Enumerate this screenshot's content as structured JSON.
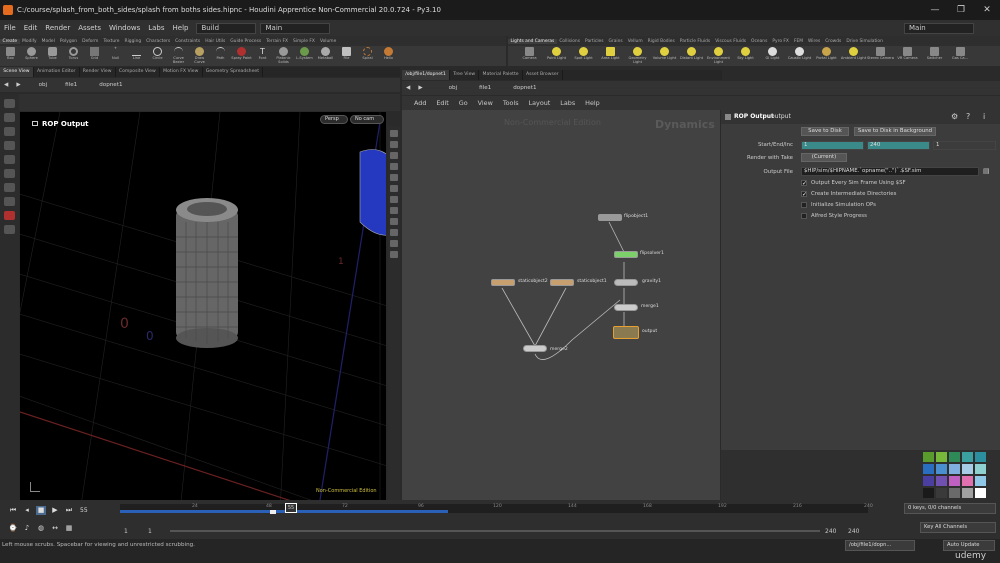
{
  "window": {
    "title": "C:/course/splash_from_both_sides/splash from boths sides.hipnc - Houdini Apprentice Non-Commercial 20.0.724 - Py3.10",
    "controls": [
      "—",
      "❐",
      "✕"
    ]
  },
  "menubar": {
    "items": [
      "File",
      "Edit",
      "Render",
      "Assets",
      "Windows",
      "Labs",
      "Help"
    ],
    "build": "Build",
    "main": "Main",
    "main_right": "Main"
  },
  "shelf_left": {
    "tabs": [
      "Create",
      "Modify",
      "Model",
      "Polygon",
      "Deform",
      "Texture",
      "Rigging",
      "Characters",
      "Constraints",
      "Hair Utils",
      "Guide Process",
      "Terrain FX",
      "Simple FX",
      "Volume"
    ],
    "tools": [
      "Box",
      "Sphere",
      "Tube",
      "Torus",
      "Grid",
      "Null",
      "Line",
      "Circle",
      "Curve Bezier",
      "Draw Curve",
      "Path",
      "Spray Paint",
      "Font",
      "Platonic Solids",
      "L-System",
      "Metaball",
      "File",
      "Spiral",
      "Helix"
    ]
  },
  "shelf_right": {
    "tabs": [
      "Lights and Cameras",
      "Collisions",
      "Particles",
      "Grains",
      "Vellum",
      "Rigid Bodies",
      "Particle Fluids",
      "Viscous Fluids",
      "Oceans",
      "Pyro FX",
      "FEM",
      "Wires",
      "Crowds",
      "Drive Simulation"
    ],
    "tools": [
      "Camera",
      "Point Light",
      "Spot Light",
      "Area Light",
      "Geometry Light",
      "Volume Light",
      "Distant Light",
      "Environment Light",
      "Sky Light",
      "GI Light",
      "Caustic Light",
      "Portal Light",
      "Ambient Light",
      "Stereo Camera",
      "VR Camera",
      "Switcher",
      "Gas Ca..."
    ]
  },
  "left_pane": {
    "tabs": [
      "Scene View",
      "Animation Editor",
      "Render View",
      "Composite View",
      "Motion FX View",
      "Geometry Spreadsheet"
    ],
    "path": [
      "obj",
      "file1",
      "dopnet1"
    ],
    "viewport_title": "ROP Output",
    "persp": "Persp",
    "cam": "No cam",
    "watermark": "Non-Commercial Edition"
  },
  "right_pane": {
    "tabs": [
      "/obj/file1/dopnet1",
      "Tree View",
      "Material Palette",
      "Asset Browser"
    ],
    "path": [
      "obj",
      "file1",
      "dopnet1"
    ],
    "menu": [
      "Add",
      "Edit",
      "Go",
      "View",
      "Tools",
      "Layout",
      "Labs",
      "Help"
    ],
    "watermark": "Non-Commercial Edition",
    "context": "Dynamics",
    "nodes": {
      "flipobject1": "flipobject1",
      "flipsolver1": "flipsolver1",
      "gravity1": "gravity1",
      "staticobject2": "staticobject2",
      "staticobject1": "staticobject1",
      "merge1": "merge1",
      "merge2": "merge2",
      "output": "output"
    }
  },
  "params": {
    "node_type": "ROP Output",
    "node_name": "output",
    "save_to_disk": "Save to Disk",
    "save_bg": "Save to Disk in Background",
    "start_end_label": "Start/End/Inc",
    "start": "1",
    "end": "240",
    "inc": "1",
    "take_label": "Render with Take",
    "take": "(Current)",
    "output_label": "Output File",
    "output_file": "$HIP/sim/$HIPNAME.`opname(\"..\")`.$SF.sim",
    "checks": [
      {
        "label": "Output Every Sim Frame Using $SF",
        "checked": true
      },
      {
        "label": "Create Intermediate Directories",
        "checked": true
      },
      {
        "label": "Initialize Simulation OPs",
        "checked": false
      },
      {
        "label": "Alfred Style Progress",
        "checked": false
      }
    ]
  },
  "palette": [
    "#5a9b2e",
    "#77b83b",
    "#2e8b57",
    "#3aa0a0",
    "#2b8fa0",
    "#2a6fbf",
    "#4a8fd0",
    "#7fb0e0",
    "#a7cde6",
    "#8fd0d0",
    "#4a3fa0",
    "#7050b0",
    "#c060c0",
    "#e070b0",
    "#90c8e8",
    "#1a1a1a",
    "#3a3a3a",
    "#6a6a6a",
    "#a0a0a0",
    "#ffffff"
  ],
  "timeline": {
    "current_frame": "55",
    "ticks": [
      "24",
      "48",
      "72",
      "96",
      "120",
      "144",
      "168",
      "192",
      "216",
      "240"
    ],
    "start": "1",
    "start2": "1",
    "end": "240",
    "end2": "240",
    "keys": "0 keys, 0/0 channels",
    "key_all": "Key All Channels"
  },
  "status": {
    "message": "Left mouse scrubs. Spacebar for viewing and unrestricted scrubbing.",
    "path": "/obj/file1/dopn...",
    "auto_update": "Auto Update",
    "brand": "udemy"
  }
}
